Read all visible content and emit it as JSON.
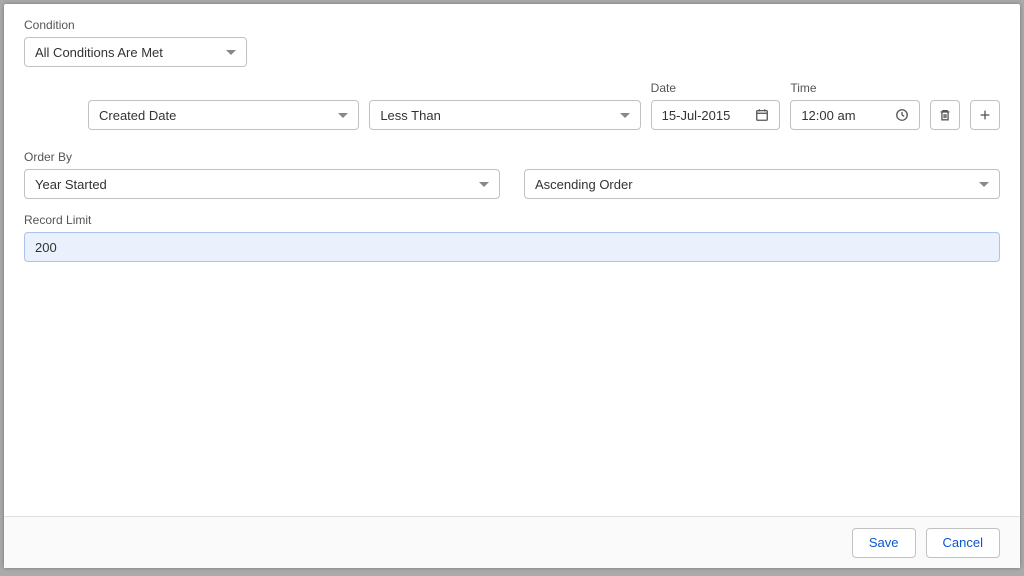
{
  "conditionLabel": "Condition",
  "conditionMode": "All Conditions Are Met",
  "conditionRow": {
    "field": "Created Date",
    "operator": "Less Than",
    "dateLabel": "Date",
    "dateValue": "15-Jul-2015",
    "timeLabel": "Time",
    "timeValue": "12:00 am"
  },
  "orderBy": {
    "label": "Order By",
    "field": "Year Started",
    "direction": "Ascending Order"
  },
  "recordLimit": {
    "label": "Record Limit",
    "value": "200"
  },
  "footer": {
    "save": "Save",
    "cancel": "Cancel"
  }
}
